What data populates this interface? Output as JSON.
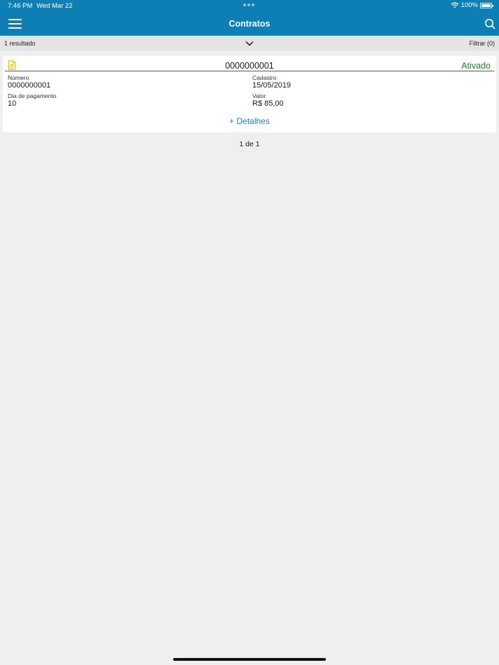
{
  "status_bar": {
    "time": "7:46 PM",
    "date": "Wed Mar 22",
    "battery": "100%",
    "battery_level": 1.0
  },
  "header": {
    "title": "Contratos",
    "menu_icon": "hamburger-menu-icon",
    "search_icon": "search-icon",
    "background_color": "#0e7fb4"
  },
  "results_bar": {
    "count_text": "1 resultado",
    "sort_icon": "chevron-down-icon",
    "filter_label": "Filtrar (0)"
  },
  "contract": {
    "icon": "document-icon",
    "number_title": "0000000001",
    "status": "Ativado",
    "status_color": "#1b8a1b",
    "fields": {
      "numero_label": "Número",
      "numero_value": "0000000001",
      "cadastro_label": "Cadastro",
      "cadastro_value": "15/05/2019",
      "dia_pagamento_label": "Dia de pagamento",
      "dia_pagamento_value": "10",
      "valor_label": "Valor",
      "valor_value": "R$ 85,00"
    },
    "details_link": "+ Detalhes"
  },
  "pagination": {
    "text": "1 de 1"
  }
}
